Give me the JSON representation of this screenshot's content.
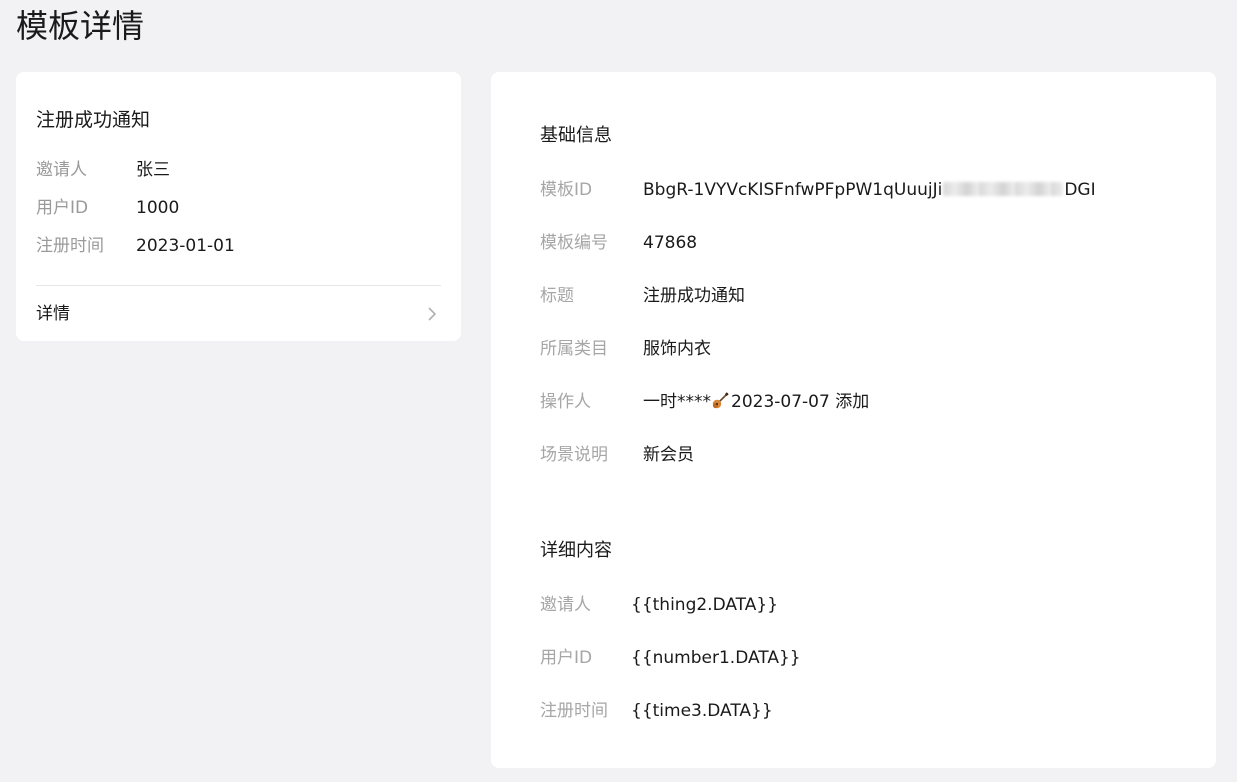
{
  "page": {
    "title": "模板详情"
  },
  "preview": {
    "title": "注册成功通知",
    "rows": [
      {
        "label": "邀请人",
        "value": "张三"
      },
      {
        "label": "用户ID",
        "value": "1000"
      },
      {
        "label": "注册时间",
        "value": "2023-01-01"
      }
    ],
    "detail_label": "详情",
    "chevron_icon": "chevron-right-icon"
  },
  "basic_info": {
    "section_title": "基础信息",
    "template_id_label": "模板ID",
    "template_id_prefix": "BbgR-1VYVcKISFnfwPFpPW1qUuujJi",
    "template_id_suffix": "DGI",
    "template_no_label": "模板编号",
    "template_no": "47868",
    "title_label": "标题",
    "title": "注册成功通知",
    "category_label": "所属类目",
    "category": "服饰内衣",
    "operator_label": "操作人",
    "operator_name": "一时****",
    "operator_icon": "guitar-icon",
    "operator_action": "2023-07-07 添加",
    "scene_label": "场景说明",
    "scene": "新会员"
  },
  "detail_content": {
    "section_title": "详细内容",
    "rows": [
      {
        "label": "邀请人",
        "value": "{{thing2.DATA}}"
      },
      {
        "label": "用户ID",
        "value": "{{number1.DATA}}"
      },
      {
        "label": "注册时间",
        "value": "{{time3.DATA}}"
      }
    ]
  },
  "colors": {
    "background": "#f2f2f4",
    "card": "#ffffff",
    "label": "#a6a6a6",
    "text": "#1a1a1a"
  }
}
